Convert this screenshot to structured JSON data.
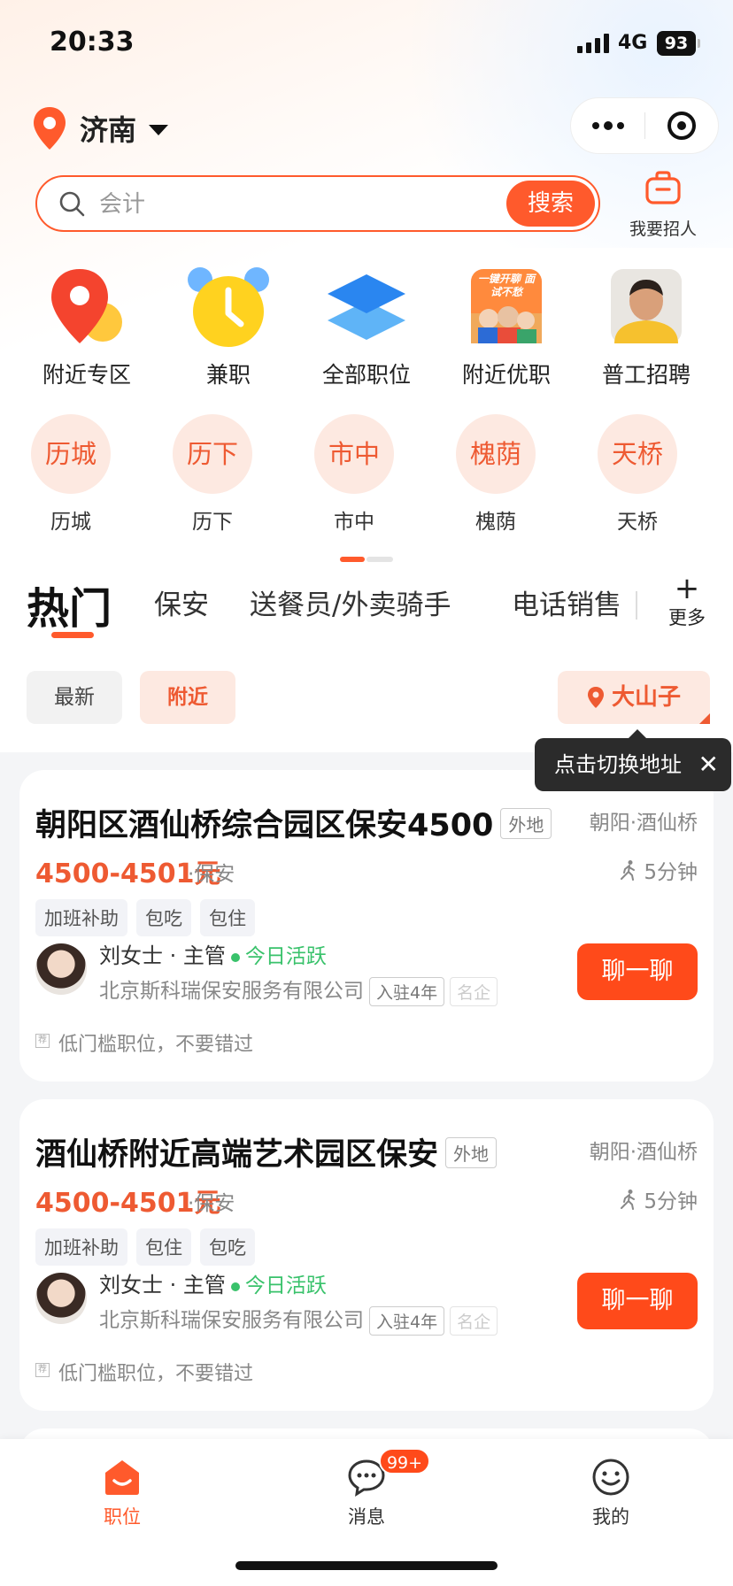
{
  "status_bar": {
    "time": "20:33",
    "network": "4G",
    "battery": "93"
  },
  "header": {
    "city": "济南",
    "recruit_label": "我要招人"
  },
  "search": {
    "placeholder": "会计",
    "button_label": "搜索"
  },
  "quick_entries": [
    {
      "label": "附近专区",
      "icon": "location-pin-icon"
    },
    {
      "label": "兼职",
      "icon": "alarm-clock-icon"
    },
    {
      "label": "全部职位",
      "icon": "stack-layers-icon"
    },
    {
      "label": "附近优职",
      "icon": "promo-poster-icon",
      "poster_text": "一键开聊 面试不愁"
    },
    {
      "label": "普工招聘",
      "icon": "worker-photo-icon"
    }
  ],
  "districts": [
    {
      "label": "历城"
    },
    {
      "label": "历下"
    },
    {
      "label": "市中"
    },
    {
      "label": "槐荫"
    },
    {
      "label": "天桥"
    }
  ],
  "tabs": {
    "items": [
      "热门",
      "保安",
      "送餐员/外卖骑手",
      "电话销售"
    ],
    "more_label": "更多"
  },
  "filters": {
    "latest": "最新",
    "nearby": "附近",
    "place": "大山子"
  },
  "tooltip": {
    "text": "点击切换地址"
  },
  "jobs": [
    {
      "title": "朝阳区酒仙桥综合园区保安4500",
      "tag": "外地",
      "location": "朝阳·酒仙桥",
      "salary": "4500-4501元",
      "category": "·保安",
      "distance": "5分钟",
      "tags": [
        "加班补助",
        "包吃",
        "包住"
      ],
      "recruiter": "刘女士 · 主管",
      "active": "今日活跃",
      "company": "北京斯科瑞保安服务有限公司",
      "badge_years": "入驻4年",
      "badge_famous": "名企",
      "chat_label": "聊一聊",
      "recommend": "低门槛职位，不要错过",
      "rec_mark": "荐"
    },
    {
      "title": "酒仙桥附近高端艺术园区保安",
      "tag": "外地",
      "location": "朝阳·酒仙桥",
      "salary": "4500-4501元",
      "category": "·保安",
      "distance": "5分钟",
      "tags": [
        "加班补助",
        "包住",
        "包吃"
      ],
      "recruiter": "刘女士 · 主管",
      "active": "今日活跃",
      "company": "北京斯科瑞保安服务有限公司",
      "badge_years": "入驻4年",
      "badge_famous": "名企",
      "chat_label": "聊一聊",
      "recommend": "低门槛职位，不要错过",
      "rec_mark": "荐"
    }
  ],
  "bottom_nav": {
    "items": [
      {
        "label": "职位",
        "icon": "job-home-icon",
        "active": true
      },
      {
        "label": "消息",
        "icon": "message-bubble-icon",
        "active": false
      },
      {
        "label": "我的",
        "icon": "smiley-profile-icon",
        "active": false
      }
    ],
    "message_badge": "99+"
  },
  "colors": {
    "accent": "#ff5a2c",
    "chat_button": "#ff4a1a",
    "active_green": "#39c26b",
    "district_bg": "#fde9e1"
  }
}
